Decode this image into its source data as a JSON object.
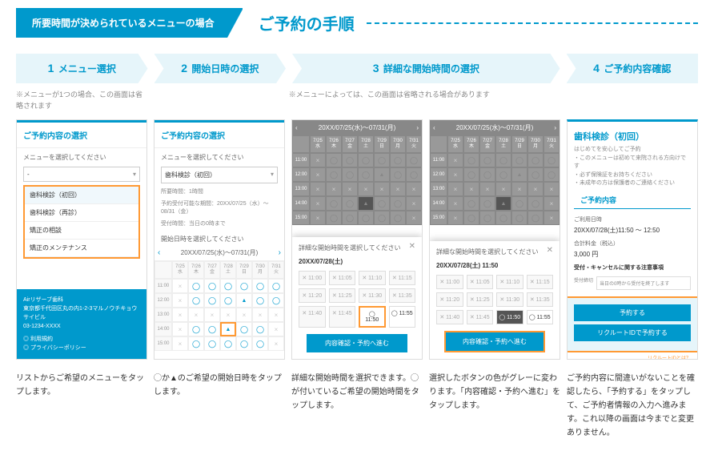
{
  "header": {
    "tag": "所要時間が決められているメニューの場合",
    "title": "ご予約の手順"
  },
  "steps": [
    {
      "num": "1",
      "label": "メニュー選択",
      "note": "※メニューが1つの場合、この画面は省略されます"
    },
    {
      "num": "2",
      "label": "開始日時の選択",
      "note": ""
    },
    {
      "num": "3",
      "label": "詳細な開始時間の選択",
      "note": "※メニューによっては、この画面は省略される場合があります",
      "wide": true
    },
    {
      "num": "4",
      "label": "ご予約内容確認",
      "note": ""
    }
  ],
  "mockup1": {
    "header": "ご予約内容の選択",
    "label": "メニューを選択してください",
    "select_placeholder": "-",
    "options": [
      "歯科検診（初回）",
      "歯科検診（再診）",
      "矯正の相談",
      "矯正のメンテナンス"
    ],
    "footer_name": "Airリザーブ歯科",
    "footer_addr": "東京都千代田区丸の内1-2-3マルノウチキョウサイビル",
    "footer_tel": "03-1234-XXXX",
    "footer_link1": "◎ 利用規約",
    "footer_link2": "◎ プライバシーポリシー"
  },
  "mockup2": {
    "header": "ご予約内容の選択",
    "label": "メニューを選択してください",
    "selected": "歯科検診（初回）",
    "info1": "所要時間：1時間",
    "info2": "予約受付可能な期間：20XX/07/25（水）〜08/31（金）",
    "info3": "受付時間：当日の0時まで",
    "label2": "開始日時を選択してください",
    "cal_title": "20XX/07/25(水)～07/31(月)",
    "days": [
      "7/25\n水",
      "7/26\n木",
      "7/27\n金",
      "7/28\n土",
      "7/29\n日",
      "7/30\n月",
      "7/31\n火"
    ],
    "times": [
      "11:00",
      "12:00",
      "13:00",
      "14:00",
      "15:00"
    ]
  },
  "mockup3": {
    "cal_title": "20XX/07/25(水)～07/31(月)",
    "modal_title": "詳細な開始時間を選択してください",
    "modal_date": "20XX/07/28(土)",
    "times": [
      "11:00",
      "11:05",
      "11:10",
      "11:15",
      "11:20",
      "11:25",
      "11:30",
      "11:35",
      "11:40",
      "11:45",
      "11:50",
      "11:55"
    ],
    "btn": "内容確認・予約へ進む",
    "hl_time": "◯ 11:50"
  },
  "mockup3b": {
    "modal_date": "20XX/07/28(土) 11:50",
    "sel_time": "◯ 11:50",
    "avail_time": "◯ 11:55"
  },
  "mockup4": {
    "title": "歯科検診（初回）",
    "sub1": "はじめてを安心してご予約",
    "sub2": "・このメニューは初めて来院される方向けです",
    "sub3": "・必ず保険証をお持ちください",
    "sub4": "・未成年の方は保護者のご連絡ください",
    "sec": "ご予約内容",
    "row1_label": "ご利用日時",
    "row1_val": "20XX/07/28(土)11:50 〜 12:50",
    "row2_label": "合計料金（税込）",
    "row2_val": "3,000 円",
    "note_title": "受付・キャンセルに関する注意事項",
    "note_label": "受付締切",
    "note_val": "当日の0時から受付を終了します",
    "btn1": "予約する",
    "btn2": "リクルートIDで予約する",
    "link": "リクルートIDとは？"
  },
  "descriptions": [
    "リストからご希望のメニューをタップします。",
    "◯か▲のご希望の開始日時をタップします。",
    "詳細な開始時間を選択できます。◯が付いているご希望の開始時間をタップします。",
    "選択したボタンの色がグレーに変わります。「内容確認・予約へ進む」をタップします。",
    "ご予約内容に間違いがないことを確認したら、「予約する」をタップして、ご予約者情報の入力へ進みます。これ以降の画面は今までと変更ありません。"
  ]
}
